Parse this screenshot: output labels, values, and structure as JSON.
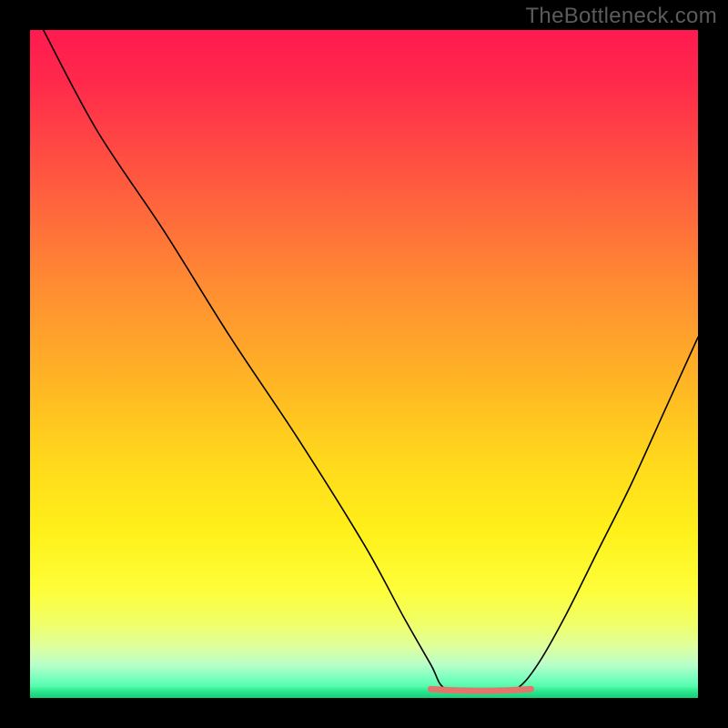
{
  "watermark": "TheBottleneck.com",
  "colors": {
    "frame": "#000000",
    "curve": "#000000",
    "flat_marker": "#e2766d"
  },
  "chart_data": {
    "type": "line",
    "title": "",
    "xlabel": "",
    "ylabel": "",
    "xlim": [
      0,
      100
    ],
    "ylim": [
      0,
      100
    ],
    "grid": false,
    "legend": false,
    "comment": "Axes are unlabeled; x and y normalized 0-100 where y=0 is the bottom (best / green) and y=100 is the top (worst / red). Valley floor near x≈62-73.",
    "series": [
      {
        "name": "bottleneck-curve",
        "x": [
          2,
          10,
          20,
          30,
          40,
          50,
          56,
          60,
          62,
          66,
          70,
          73,
          76,
          80,
          85,
          90,
          95,
          100
        ],
        "y": [
          100,
          85,
          70,
          54,
          39,
          23,
          12,
          5,
          1.5,
          1,
          1,
          1.5,
          5,
          12,
          22,
          32,
          43,
          54
        ]
      }
    ],
    "flat_region": {
      "x_start": 60,
      "x_end": 75,
      "y": 1.2
    },
    "background_gradient": {
      "orientation": "vertical",
      "stops": [
        {
          "pos": 0.0,
          "color": "#ff1a4f"
        },
        {
          "pos": 0.5,
          "color": "#ffb325"
        },
        {
          "pos": 0.78,
          "color": "#fff01a"
        },
        {
          "pos": 0.95,
          "color": "#b9ffc9"
        },
        {
          "pos": 1.0,
          "color": "#16cf78"
        }
      ]
    }
  }
}
